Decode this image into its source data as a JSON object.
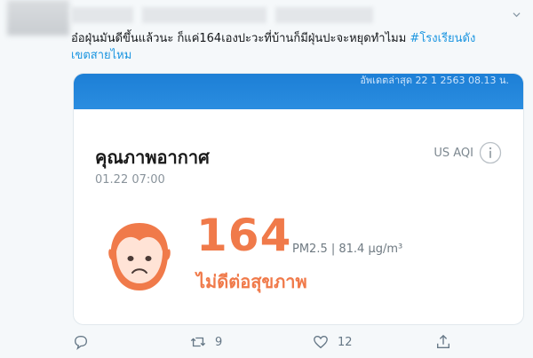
{
  "tweet": {
    "text_main": "อ๋อฝุ่นมันดีขึ้นแล้วนะ ก็แค่164เองปะวะที่บ้านก็มีฝุ่นปะจะหยุดทำไมม",
    "hashtag_line1": "#โรงเรียนดัง",
    "hashtag_line2": "เขตสายไหม"
  },
  "card": {
    "updated": "อัพเดตล่าสุด 22 1 2563 08.13 น.",
    "title": "คุณภาพอากาศ",
    "date": "01.22 07:00",
    "aqi_label": "US AQI",
    "aqi_value": "164",
    "pm_text": "PM2.5 | 81.4 µg/m³",
    "status": "ไม่ดีต่อสุขภาพ",
    "accent_color": "#f07a4a",
    "header_color": "#1d7fd6"
  },
  "actions": {
    "retweets": "9",
    "likes": "12"
  }
}
